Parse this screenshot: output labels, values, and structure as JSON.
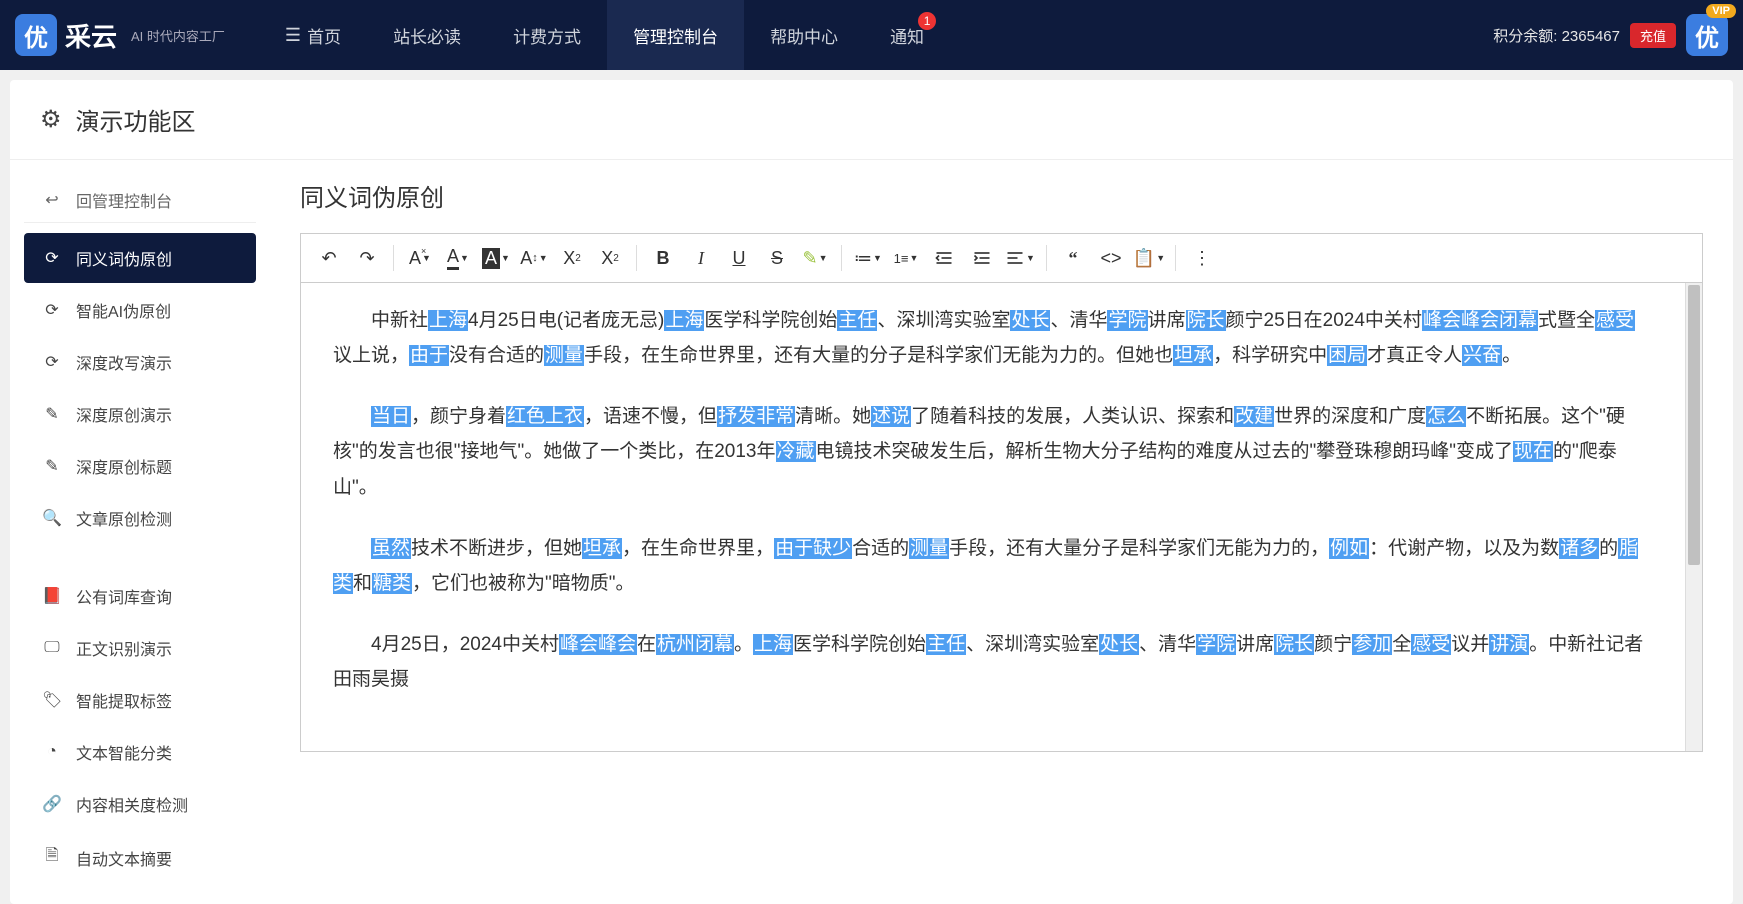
{
  "topbar": {
    "logo_char": "优",
    "logo_text": "采云",
    "logo_sub": "AI 时代内容工厂",
    "nav": [
      {
        "label": "首页",
        "icon": true
      },
      {
        "label": "站长必读"
      },
      {
        "label": "计费方式"
      },
      {
        "label": "管理控制台",
        "active": true
      },
      {
        "label": "帮助中心"
      },
      {
        "label": "通知",
        "badge": "1"
      }
    ],
    "points_label": "积分余额:",
    "points_value": "2365467",
    "recharge": "充值",
    "vip": "VIP"
  },
  "page": {
    "header": "演示功能区",
    "back": "回管理控制台",
    "sidebar_a": [
      {
        "icon": "sync",
        "label": "同义词伪原创",
        "active": true
      },
      {
        "icon": "sync",
        "label": "智能AI伪原创"
      },
      {
        "icon": "sync",
        "label": "深度改写演示"
      },
      {
        "icon": "edit",
        "label": "深度原创演示"
      },
      {
        "icon": "edit",
        "label": "深度原创标题"
      },
      {
        "icon": "search",
        "label": "文章原创检测"
      }
    ],
    "sidebar_b": [
      {
        "icon": "book",
        "label": "公有词库查询"
      },
      {
        "icon": "monitor",
        "label": "正文识别演示"
      },
      {
        "icon": "tag",
        "label": "智能提取标签"
      },
      {
        "icon": "pie",
        "label": "文本智能分类"
      },
      {
        "icon": "link",
        "label": "内容相关度检测"
      },
      {
        "icon": "doc",
        "label": "自动文本摘要"
      }
    ],
    "main_title": "同义词伪原创"
  },
  "content": {
    "paragraphs": [
      [
        {
          "t": "中新社"
        },
        {
          "t": "上海",
          "hl": true
        },
        {
          "t": "4月25日电(记者庞无忌)"
        },
        {
          "t": "上海",
          "hl": true
        },
        {
          "t": "医学科学院创始"
        },
        {
          "t": "主任",
          "hl": true
        },
        {
          "t": "、深圳湾实验室"
        },
        {
          "t": "处长",
          "hl": true
        },
        {
          "t": "、清华"
        },
        {
          "t": "学院",
          "hl": true
        },
        {
          "t": "讲席"
        },
        {
          "t": "院长",
          "hl": true
        },
        {
          "t": "颜宁25日在2024中关村"
        },
        {
          "t": "峰会峰会闭幕",
          "hl": true
        },
        {
          "t": "式暨全"
        },
        {
          "t": "感受",
          "hl": true
        },
        {
          "t": "议上说，"
        },
        {
          "t": "由于",
          "hl": true
        },
        {
          "t": "没有合适的"
        },
        {
          "t": "测量",
          "hl": true
        },
        {
          "t": "手段，在生命世界里，还有大量的分子是科学家们无能为力的。但她也"
        },
        {
          "t": "坦承",
          "hl": true
        },
        {
          "t": "，科学研究中"
        },
        {
          "t": "困局",
          "hl": true
        },
        {
          "t": "才真正令人"
        },
        {
          "t": "兴奋",
          "hl": true
        },
        {
          "t": "。"
        }
      ],
      [
        {
          "t": "当日",
          "hl": true
        },
        {
          "t": "，颜宁身着"
        },
        {
          "t": "红色上衣",
          "hl": true
        },
        {
          "t": "，语速不慢，但"
        },
        {
          "t": "抒发非常",
          "hl": true
        },
        {
          "t": "清晰。她"
        },
        {
          "t": "述说",
          "hl": true
        },
        {
          "t": "了随着科技的发展，人类认识、探索和"
        },
        {
          "t": "改建",
          "hl": true
        },
        {
          "t": "世界的深度和广度"
        },
        {
          "t": "怎么",
          "hl": true
        },
        {
          "t": "不断拓展。这个\"硬核\"的发言也很\"接地气\"。她做了一个类比，在2013年"
        },
        {
          "t": "冷藏",
          "hl": true
        },
        {
          "t": "电镜技术突破发生后，解析生物大分子结构的难度从过去的\"攀登珠穆朗玛峰\"变成了"
        },
        {
          "t": "现在",
          "hl": true
        },
        {
          "t": "的\"爬泰山\"。"
        }
      ],
      [
        {
          "t": "虽然",
          "hl": true
        },
        {
          "t": "技术不断进步，但她"
        },
        {
          "t": "坦承",
          "hl": true
        },
        {
          "t": "，在生命世界里，"
        },
        {
          "t": "由于缺少",
          "hl": true
        },
        {
          "t": "合适的"
        },
        {
          "t": "测量",
          "hl": true
        },
        {
          "t": "手段，还有大量分子是科学家们无能为力的，"
        },
        {
          "t": "例如",
          "hl": true
        },
        {
          "t": "：代谢产物，以及为数"
        },
        {
          "t": "诸多",
          "hl": true
        },
        {
          "t": "的"
        },
        {
          "t": "脂类",
          "hl": true
        },
        {
          "t": "和"
        },
        {
          "t": "糖类",
          "hl": true
        },
        {
          "t": "，它们也被称为\"暗物质\"。"
        }
      ],
      [
        {
          "t": "4月25日，2024中关村"
        },
        {
          "t": "峰会峰会",
          "hl": true
        },
        {
          "t": "在"
        },
        {
          "t": "杭州闭幕",
          "hl": true
        },
        {
          "t": "。"
        },
        {
          "t": "上海",
          "hl": true
        },
        {
          "t": "医学科学院创始"
        },
        {
          "t": "主任",
          "hl": true
        },
        {
          "t": "、深圳湾实验室"
        },
        {
          "t": "处长",
          "hl": true
        },
        {
          "t": "、清华"
        },
        {
          "t": "学院",
          "hl": true
        },
        {
          "t": "讲席"
        },
        {
          "t": "院长",
          "hl": true
        },
        {
          "t": "颜宁"
        },
        {
          "t": "参加",
          "hl": true
        },
        {
          "t": "全"
        },
        {
          "t": "感受",
          "hl": true
        },
        {
          "t": "议并"
        },
        {
          "t": "讲演",
          "hl": true
        },
        {
          "t": "。中新社记者田雨昊摄"
        }
      ]
    ]
  },
  "icons": {
    "sync": "⟳",
    "edit": "✎",
    "search": "🔍",
    "book": "📕",
    "monitor": "🖵",
    "tag": "🏷",
    "pie": "◔",
    "link": "🔗",
    "doc": "🗎",
    "back": "↩",
    "home": "☰"
  }
}
